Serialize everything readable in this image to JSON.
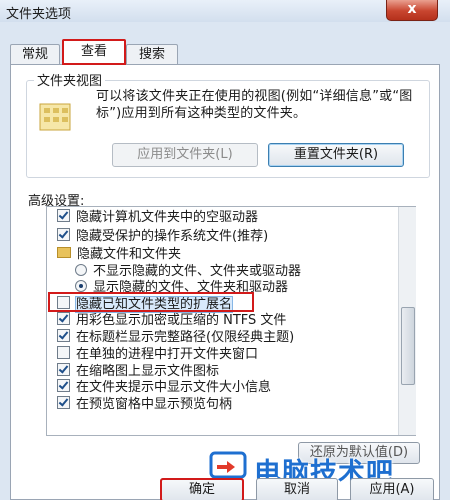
{
  "window": {
    "title": "文件夹选项",
    "close_glyph": "x"
  },
  "tabs": [
    {
      "label": "常规"
    },
    {
      "label": "查看"
    },
    {
      "label": "搜索"
    }
  ],
  "folder_views": {
    "group_title": "文件夹视图",
    "description": "可以将该文件夹正在使用的视图(例如“详细信息”或“图标”)应用到所有这种类型的文件夹。",
    "apply_button": "应用到文件夹(L)",
    "reset_button": "重置文件夹(R)"
  },
  "advanced": {
    "label": "高级设置:",
    "items": [
      {
        "type": "checkbox",
        "checked": true,
        "label": "隐藏计算机文件夹中的空驱动器"
      },
      {
        "type": "checkbox",
        "checked": true,
        "label": "隐藏受保护的操作系统文件(推荐)"
      },
      {
        "type": "folder",
        "label": "隐藏文件和文件夹"
      },
      {
        "type": "radio",
        "selected": false,
        "label": "不显示隐藏的文件、文件夹或驱动器"
      },
      {
        "type": "radio",
        "selected": true,
        "label": "显示隐藏的文件、文件夹和驱动器"
      },
      {
        "type": "checkbox",
        "checked": false,
        "label": "隐藏已知文件类型的扩展名",
        "highlighted": true
      },
      {
        "type": "checkbox",
        "checked": true,
        "label": "用彩色显示加密或压缩的 NTFS 文件"
      },
      {
        "type": "checkbox",
        "checked": true,
        "label": "在标题栏显示完整路径(仅限经典主题)"
      },
      {
        "type": "checkbox",
        "checked": false,
        "label": "在单独的进程中打开文件夹窗口"
      },
      {
        "type": "checkbox",
        "checked": true,
        "label": "在缩略图上显示文件图标"
      },
      {
        "type": "checkbox",
        "checked": true,
        "label": "在文件夹提示中显示文件大小信息"
      },
      {
        "type": "checkbox",
        "checked": true,
        "label": "在预览窗格中显示预览句柄"
      }
    ],
    "restore_button": "还原为默认值(D)"
  },
  "footer": {
    "ok": "确定",
    "cancel": "取消",
    "apply": "应用(A)"
  },
  "watermark": {
    "text": "电脑技术吧"
  },
  "colors": {
    "annotation_red": "#d21a1a",
    "watermark_blue": "#1e6fd0"
  }
}
